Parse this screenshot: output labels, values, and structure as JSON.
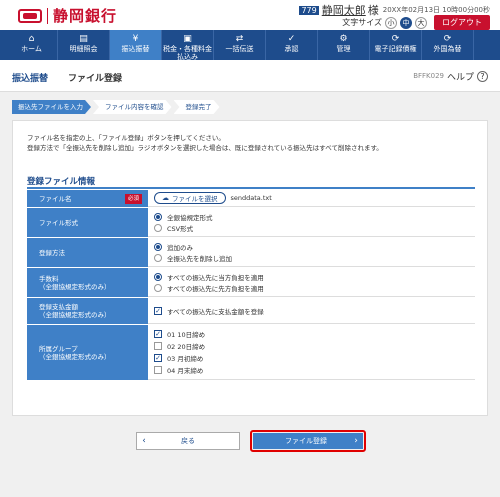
{
  "header": {
    "bank_name": "静岡銀行",
    "user_badge": "779",
    "user_name": "静岡太郎",
    "user_suffix": "様",
    "timestamp": "20XX年02月13日 10時00分00秒",
    "text_size_label": "文字サイズ",
    "text_sizes": [
      "小",
      "中",
      "大"
    ],
    "text_size_selected": "中",
    "logout_label": "ログアウト"
  },
  "nav": {
    "items": [
      {
        "icon": "home-icon",
        "glyph": "⌂",
        "label": "ホーム",
        "label2": ""
      },
      {
        "icon": "statement-icon",
        "glyph": "▤",
        "label": "明細照会",
        "label2": ""
      },
      {
        "icon": "transfer-icon",
        "glyph": "¥",
        "label": "振込振替",
        "label2": "",
        "active": true
      },
      {
        "icon": "tax-payment-icon",
        "glyph": "▣",
        "label": "税金・各種料金",
        "label2": "払込み"
      },
      {
        "icon": "bulk-transfer-icon",
        "glyph": "⇄",
        "label": "一括伝送",
        "label2": ""
      },
      {
        "icon": "approval-icon",
        "glyph": "✓",
        "label": "承認",
        "label2": ""
      },
      {
        "icon": "management-icon",
        "glyph": "⚙",
        "label": "管理",
        "label2": ""
      },
      {
        "icon": "e-record-icon",
        "glyph": "⟳",
        "label": "電子記録債権",
        "label2": ""
      },
      {
        "icon": "forex-icon",
        "glyph": "⟳",
        "label": "外国為替",
        "label2": ""
      }
    ]
  },
  "page": {
    "category": "振込振替",
    "title": "ファイル登録",
    "screen_id": "BFFK029",
    "help_label": "ヘルプ",
    "help_glyph": "?"
  },
  "steps": [
    "振込先ファイルを入力",
    "ファイル内容を確認",
    "登録完了"
  ],
  "intro": {
    "line1": "ファイル名を指定の上、「ファイル登録」ボタンを押してください。",
    "line2": "登録方法で「全振込先を削除し追加」ラジオボタンを選択した場合は、既に登録されている振込先はすべて削除されます。"
  },
  "form": {
    "section_title": "登録ファイル情報",
    "file_name": {
      "label": "ファイル名",
      "required": "必須",
      "button_label": "ファイルを選択",
      "selected_file": "senddata.txt"
    },
    "file_format": {
      "label": "ファイル形式",
      "options": [
        "全銀協規定形式",
        "CSV形式"
      ],
      "selected": 0
    },
    "register_method": {
      "label": "登録方法",
      "options": [
        "追加のみ",
        "全振込先を削除し追加"
      ],
      "selected": 0
    },
    "fee": {
      "label": "手数料",
      "label2": "（全銀協規定形式のみ）",
      "options": [
        "すべての振込先に当方負担を適用",
        "すべての振込先に先方負担を適用"
      ],
      "selected": 0
    },
    "payment_amount": {
      "label": "登録支払金額",
      "label2": "（全銀協規定形式のみ）",
      "option": "すべての振込先に支払金額を登録",
      "checked": true
    },
    "group": {
      "label": "所属グループ",
      "label2": "（全銀協規定形式のみ）",
      "options": [
        {
          "text": "01 10日締め",
          "checked": true
        },
        {
          "text": "02 20日締め",
          "checked": false
        },
        {
          "text": "03 月初締め",
          "checked": true
        },
        {
          "text": "04 月末締め",
          "checked": false
        }
      ]
    }
  },
  "buttons": {
    "back_label": "戻る",
    "back_glyph": "‹",
    "submit_label": "ファイル登録",
    "submit_glyph": "›"
  },
  "colors": {
    "brand_red": "#c8102e",
    "nav_blue": "#1e4c8c",
    "accent_blue": "#3f80c7",
    "highlight_red": "#e00000"
  }
}
